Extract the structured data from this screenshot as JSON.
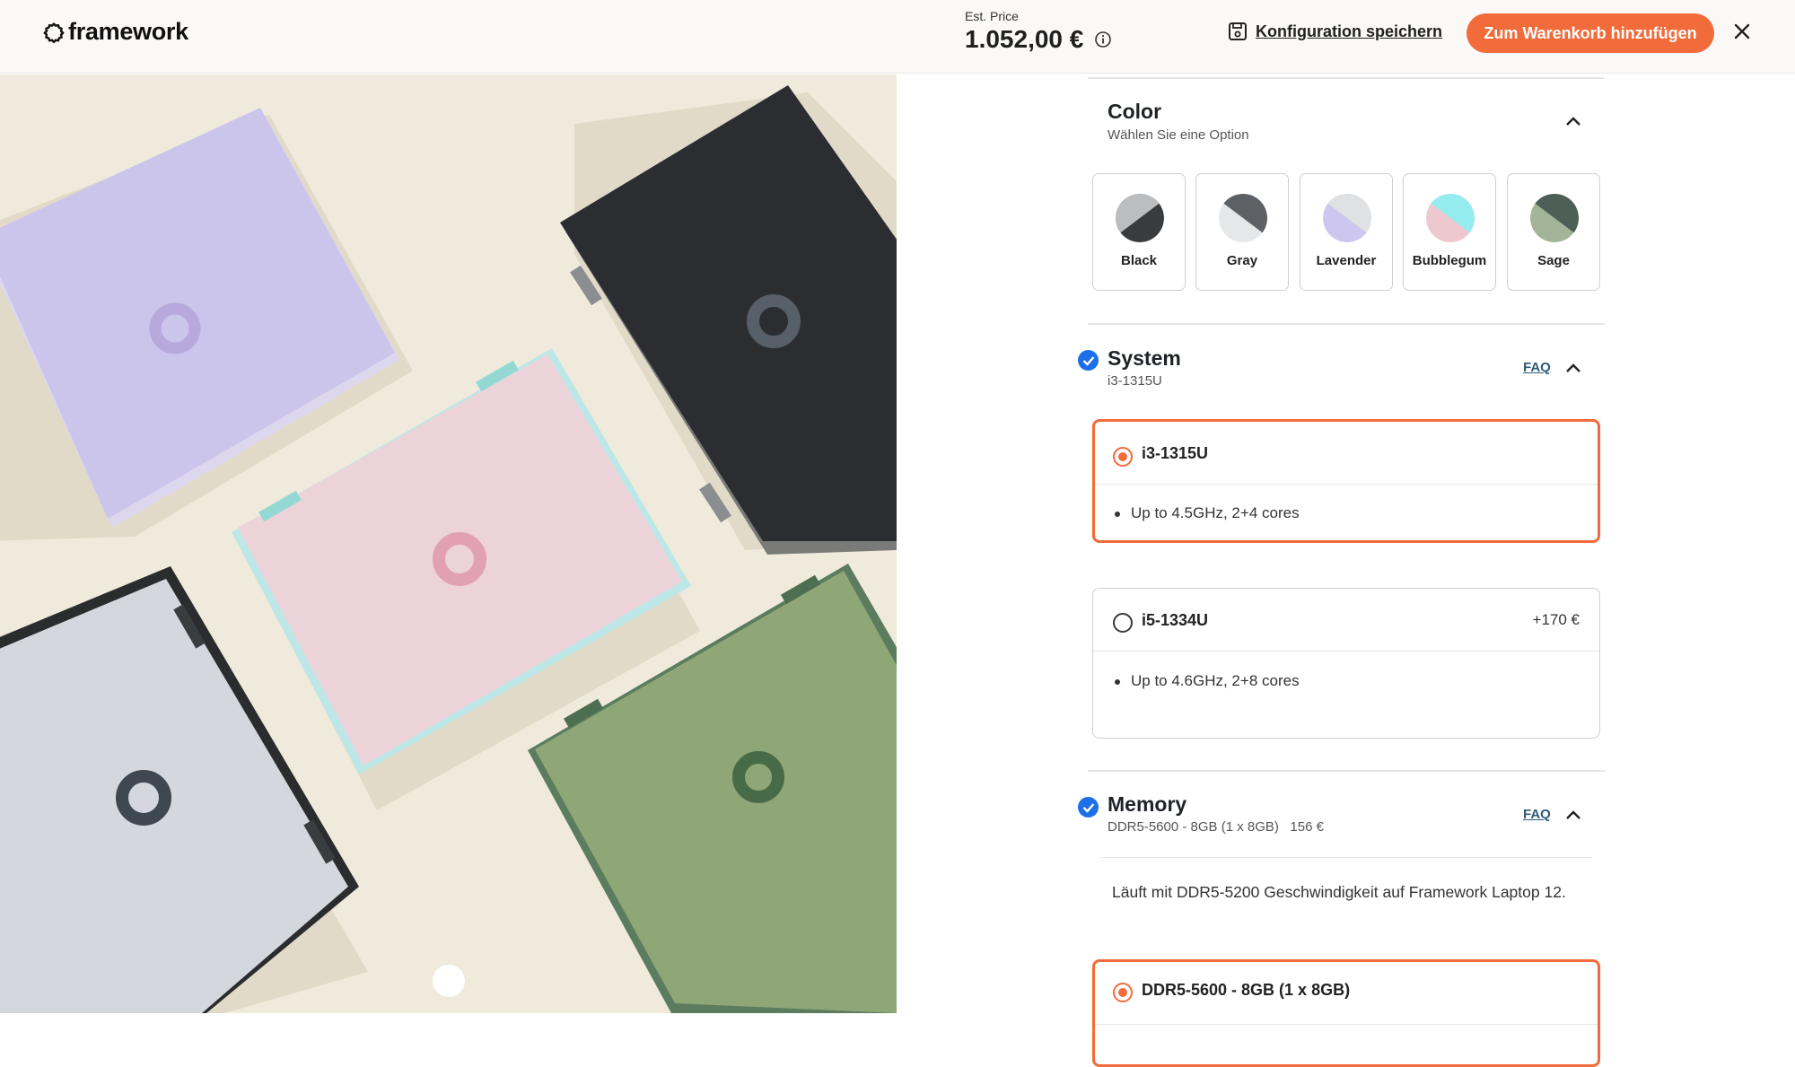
{
  "header": {
    "logo_text": "framework",
    "est_price_label": "Est. Price",
    "price": "1.052,00 €",
    "save_config_label": "Konfiguration speichern",
    "add_to_cart_label": "Zum Warenkorb hinzufügen"
  },
  "colors": {
    "accent": "#f26b3a",
    "check_blue": "#1c6fe6",
    "link": "#2f5b77"
  },
  "color_section": {
    "title": "Color",
    "subtitle": "Wählen Sie eine Option",
    "options": [
      {
        "name": "Black",
        "icon": "swatch-black"
      },
      {
        "name": "Gray",
        "icon": "swatch-gray"
      },
      {
        "name": "Lavender",
        "icon": "swatch-lavender"
      },
      {
        "name": "Bubblegum",
        "icon": "swatch-bubblegum"
      },
      {
        "name": "Sage",
        "icon": "swatch-sage"
      }
    ]
  },
  "system_section": {
    "title": "System",
    "subtitle": "i3-1315U",
    "faq": "FAQ",
    "options": [
      {
        "label": "i3-1315U",
        "price": "",
        "detail": "Up to 4.5GHz, 2+4 cores",
        "selected": true
      },
      {
        "label": "i5-1334U",
        "price": "+170 €",
        "detail": "Up to 4.6GHz, 2+8 cores",
        "selected": false
      }
    ]
  },
  "memory_section": {
    "title": "Memory",
    "subtitle": "DDR5-5600 - 8GB (1 x 8GB)",
    "subtitle_price": "156 €",
    "faq": "FAQ",
    "note": "Läuft mit DDR5-5200 Geschwindigkeit auf Framework Laptop 12.",
    "options": [
      {
        "label": "DDR5-5600 - 8GB (1 x 8GB)",
        "selected": true
      }
    ]
  }
}
